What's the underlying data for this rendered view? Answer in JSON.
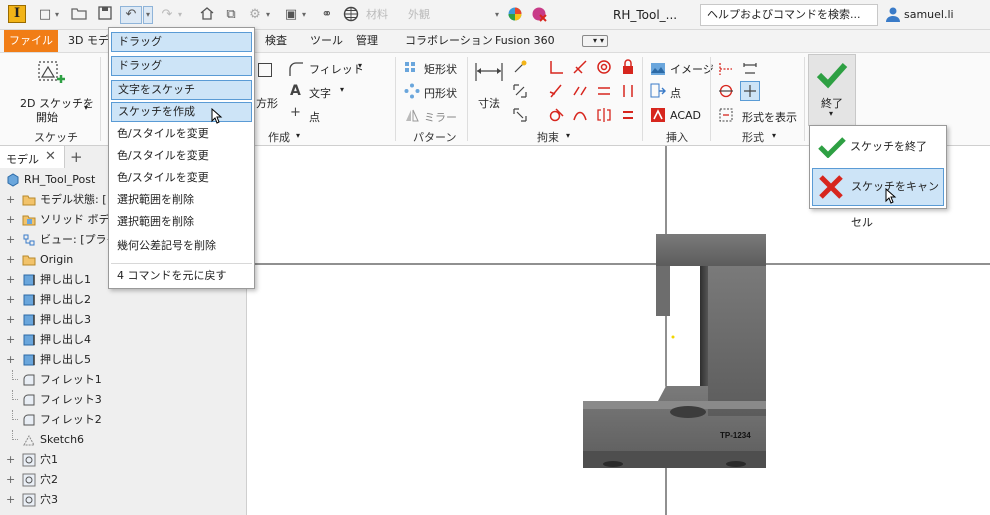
{
  "titlebar": {
    "logo": "I",
    "material_placeholder": "材料",
    "appearance_placeholder": "外観",
    "doc_title": "RH_Tool_...",
    "search_placeholder": "ヘルプおよびコマンドを検索...",
    "user_name": "samuel.li"
  },
  "ribbon_tabs": {
    "file": "ファイル",
    "model": "3D モデ",
    "inspect": "検査",
    "tools": "ツール",
    "manage": "管理",
    "collaborate": "コラボレーション",
    "fusion": "Fusion 360"
  },
  "ribbon": {
    "sketch_panel": {
      "start_2d_line1": "2D スケッチを",
      "start_2d_line2": "開始",
      "title": "スケッチ"
    },
    "create_panel": {
      "shape_partial": "方形",
      "fillet": "フィレット",
      "text": "文字",
      "point": "点",
      "title": "作成"
    },
    "pattern_panel": {
      "rect": "矩形状",
      "circ": "円形状",
      "mirror": "ミラー",
      "title": "パターン"
    },
    "constrain_panel": {
      "dimension": "寸法",
      "title": "拘束"
    },
    "insert_panel": {
      "image": "イメージ",
      "points": "点",
      "acad": "ACAD",
      "title": "挿入"
    },
    "format_panel": {
      "show_format": "形式を表示",
      "title": "形式"
    },
    "exit_panel": {
      "finish": "終了"
    }
  },
  "undo_menu": {
    "items": [
      "ドラッグ",
      "ドラッグ",
      "文字をスケッチ",
      "スケッチを作成",
      "色/スタイルを変更",
      "色/スタイルを変更",
      "色/スタイルを変更",
      "選択範囲を削除",
      "選択範囲を削除",
      "幾何公差記号を削除"
    ],
    "footer": "4 コマンドを元に戻す"
  },
  "finish_menu": {
    "finish_sketch": "スケッチを終了",
    "cancel_sketch": "スケッチをキャンセル"
  },
  "browser": {
    "tab_label": "モデル",
    "items": [
      "RH_Tool_Post",
      "モデル状態: [フ",
      "ソリッド ボディ(",
      "ビュー: [プライマ",
      "Origin",
      "押し出し1",
      "押し出し2",
      "押し出し3",
      "押し出し4",
      "押し出し5",
      "フィレット1",
      "フィレット3",
      "フィレット2",
      "Sketch6",
      "穴1",
      "穴2",
      "穴3"
    ]
  },
  "canvas": {
    "part_label": "TP-1234"
  },
  "colors": {
    "file_tab": "#f17d16",
    "selection": "#cde4f7",
    "selection_border": "#5a9bd5",
    "finish_green": "#2ea043",
    "cancel_red": "#d7261e",
    "part_gray": "#6b6b6b"
  }
}
